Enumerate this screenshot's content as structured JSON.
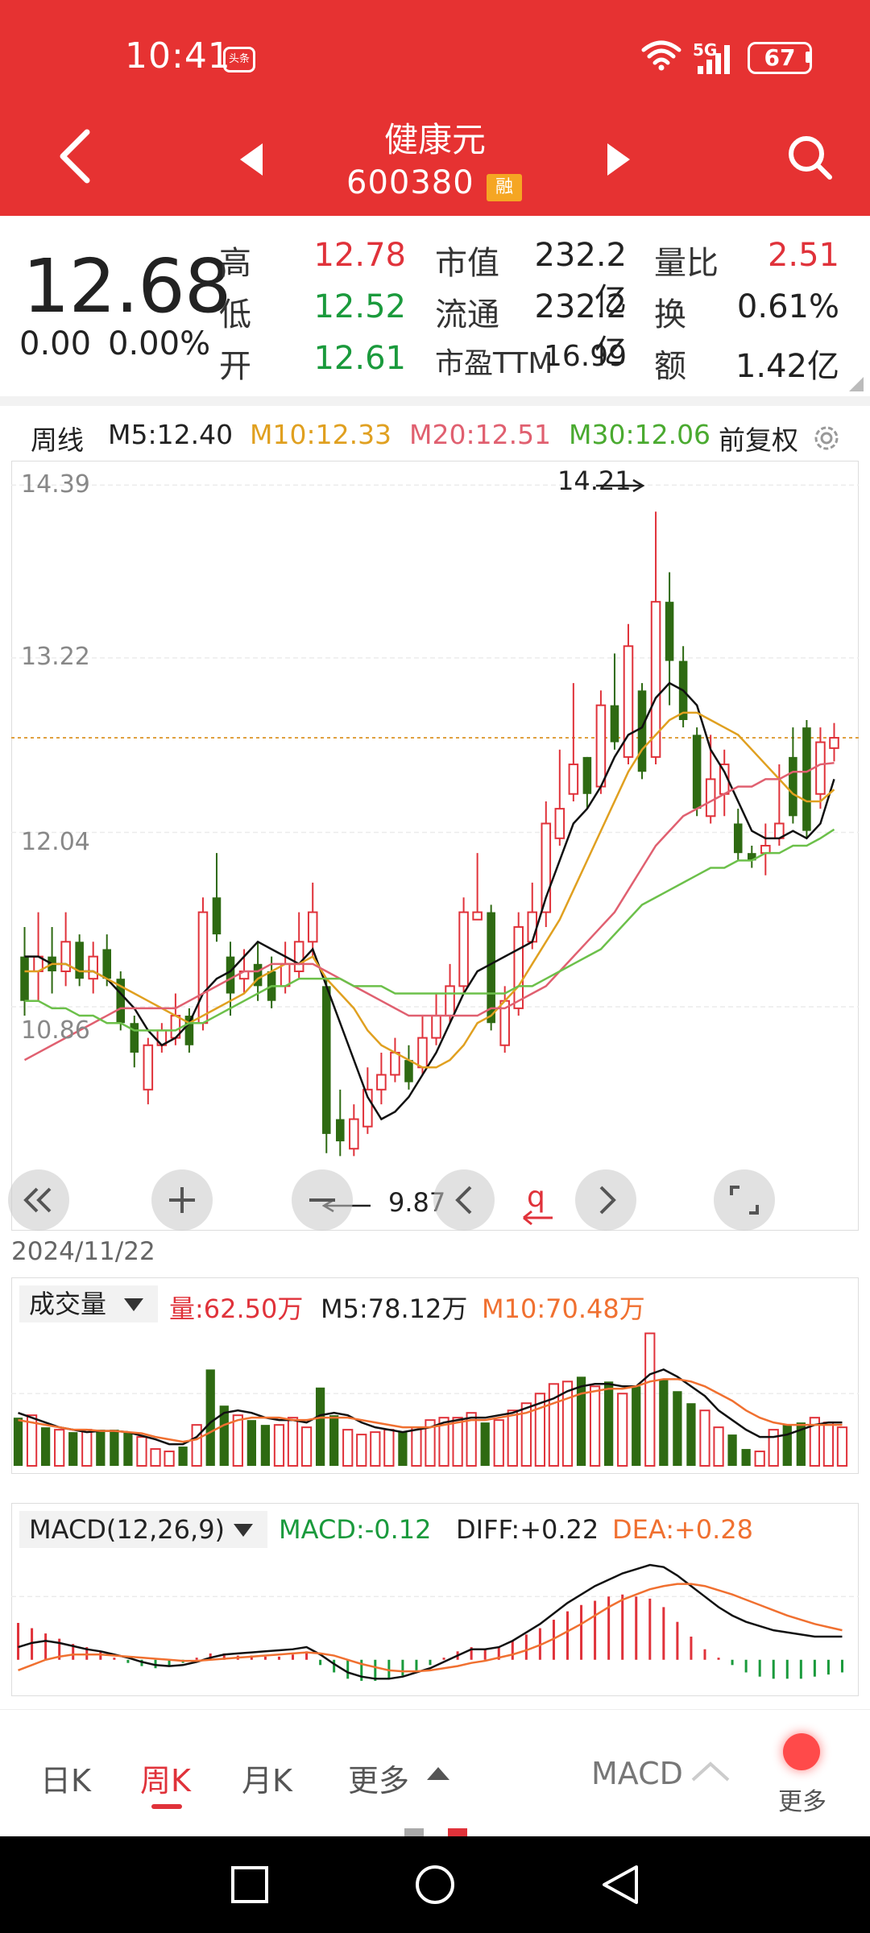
{
  "status_bar": {
    "time": "10:41",
    "toutiao": "头条",
    "network": "5G",
    "battery": "67"
  },
  "header": {
    "stock_name": "健康元",
    "stock_code": "600380",
    "badge": "融"
  },
  "quote": {
    "price": "12.68",
    "change": "0.00",
    "change_pct": "0.00%",
    "rows": [
      {
        "label": "高",
        "value": "12.78",
        "label2": "市值",
        "value2": "232.2亿",
        "label3": "量比",
        "value3": "2.51"
      },
      {
        "label": "低",
        "value": "12.52",
        "label2": "流通",
        "value2": "232.2亿",
        "label3": "换",
        "value3": "0.61%"
      },
      {
        "label": "开",
        "value": "12.61",
        "label2": "市盈TTM",
        "value2": "16.99",
        "label3": "额",
        "value3": "1.42亿"
      }
    ]
  },
  "ma_bar": {
    "period": "周线",
    "m5": "M5:12.40",
    "m10": "M10:12.33",
    "m20": "M20:12.51",
    "m30": "M30:12.06",
    "adjust": "前复权"
  },
  "colors": {
    "up": "#e0323a",
    "down": "#2e6a12",
    "m5": "#111111",
    "m10": "#e0a020",
    "m20": "#e06070",
    "m30": "#6cc04a",
    "header": "#e63232"
  },
  "chart_data": {
    "type": "candlestick",
    "y_ticks": [
      "14.39",
      "13.22",
      "12.04",
      "10.86"
    ],
    "ylim": [
      9.4,
      14.5
    ],
    "max_label": "14.21",
    "min_label": "9.87",
    "date_label": "2024/11/22",
    "current_price": 12.68,
    "candles": [
      [
        11.2,
        10.9,
        11.4,
        10.8
      ],
      [
        11.1,
        11.2,
        11.5,
        10.9
      ],
      [
        11.2,
        11.1,
        11.4,
        10.95
      ],
      [
        11.1,
        11.3,
        11.5,
        11.0
      ],
      [
        11.3,
        11.05,
        11.35,
        11.0
      ],
      [
        11.05,
        11.2,
        11.3,
        10.95
      ],
      [
        11.25,
        11.05,
        11.35,
        11.0
      ],
      [
        11.05,
        10.75,
        11.1,
        10.7
      ],
      [
        10.75,
        10.55,
        10.8,
        10.45
      ],
      [
        10.3,
        10.6,
        10.65,
        10.2
      ],
      [
        10.6,
        10.7,
        10.75,
        10.55
      ],
      [
        10.65,
        10.8,
        10.95,
        10.6
      ],
      [
        10.8,
        10.6,
        10.85,
        10.55
      ],
      [
        10.75,
        11.5,
        11.6,
        10.7
      ],
      [
        11.6,
        11.35,
        11.9,
        11.3
      ],
      [
        11.2,
        10.95,
        11.3,
        10.8
      ],
      [
        11.05,
        11.1,
        11.25,
        10.95
      ],
      [
        11.15,
        11.0,
        11.3,
        10.9
      ],
      [
        11.1,
        10.9,
        11.2,
        10.85
      ],
      [
        11.0,
        11.15,
        11.3,
        10.95
      ],
      [
        11.1,
        11.3,
        11.5,
        11.05
      ],
      [
        11.3,
        11.5,
        11.7,
        11.2
      ],
      [
        11.0,
        10.0,
        11.05,
        9.87
      ],
      [
        10.1,
        9.95,
        10.3,
        9.85
      ],
      [
        9.9,
        10.1,
        10.2,
        9.85
      ],
      [
        10.05,
        10.3,
        10.45,
        10.0
      ],
      [
        10.3,
        10.4,
        10.55,
        10.2
      ],
      [
        10.4,
        10.55,
        10.65,
        10.35
      ],
      [
        10.5,
        10.35,
        10.6,
        10.3
      ],
      [
        10.45,
        10.65,
        10.8,
        10.4
      ],
      [
        10.65,
        10.8,
        10.95,
        10.6
      ],
      [
        10.8,
        11.0,
        11.15,
        10.75
      ],
      [
        11.0,
        11.5,
        11.6,
        10.95
      ],
      [
        11.45,
        11.5,
        11.9,
        11.45
      ],
      [
        11.5,
        10.75,
        11.55,
        10.7
      ],
      [
        10.6,
        10.9,
        11.0,
        10.55
      ],
      [
        10.85,
        11.4,
        11.5,
        10.8
      ],
      [
        11.3,
        11.5,
        11.7,
        11.25
      ],
      [
        11.5,
        12.1,
        12.25,
        11.4
      ],
      [
        12.0,
        12.2,
        12.6,
        11.95
      ],
      [
        12.3,
        12.5,
        13.05,
        12.25
      ],
      [
        12.55,
        12.3,
        12.55,
        12.2
      ],
      [
        12.35,
        12.9,
        13.0,
        12.3
      ],
      [
        12.9,
        12.65,
        13.25,
        12.6
      ],
      [
        12.55,
        13.3,
        13.45,
        12.5
      ],
      [
        13.0,
        12.45,
        13.05,
        12.4
      ],
      [
        12.55,
        13.6,
        14.21,
        12.5
      ],
      [
        13.6,
        13.2,
        13.8,
        12.9
      ],
      [
        13.2,
        12.8,
        13.3,
        12.75
      ],
      [
        12.7,
        12.2,
        12.75,
        12.15
      ],
      [
        12.15,
        12.4,
        12.7,
        12.1
      ],
      [
        12.3,
        12.5,
        12.6,
        12.15
      ],
      [
        12.1,
        11.9,
        12.2,
        11.85
      ],
      [
        11.9,
        11.85,
        11.95,
        11.8
      ],
      [
        11.9,
        11.95,
        12.1,
        11.75
      ],
      [
        12.0,
        12.1,
        12.5,
        11.95
      ],
      [
        12.55,
        12.15,
        12.75,
        12.1
      ],
      [
        12.75,
        12.05,
        12.8,
        12.0
      ],
      [
        12.3,
        12.65,
        12.75,
        12.2
      ],
      [
        12.61,
        12.68,
        12.78,
        12.52
      ]
    ],
    "ma": {
      "m5": [
        11.2,
        11.2,
        11.15,
        11.15,
        11.1,
        11.1,
        11.05,
        10.95,
        10.85,
        10.7,
        10.6,
        10.65,
        10.75,
        10.95,
        11.05,
        11.1,
        11.2,
        11.3,
        11.25,
        11.2,
        11.15,
        11.25,
        11.0,
        10.75,
        10.5,
        10.25,
        10.1,
        10.15,
        10.25,
        10.4,
        10.55,
        10.75,
        10.95,
        11.1,
        11.15,
        11.2,
        11.25,
        11.3,
        11.6,
        11.85,
        12.1,
        12.2,
        12.35,
        12.55,
        12.7,
        12.75,
        12.95,
        13.05,
        13.0,
        12.9,
        12.6,
        12.45,
        12.25,
        12.05,
        12.0,
        12.0,
        12.05,
        12.0,
        12.1,
        12.4
      ],
      "m10": [
        11.1,
        11.1,
        11.15,
        11.15,
        11.1,
        11.1,
        11.05,
        11.0,
        10.95,
        10.9,
        10.85,
        10.8,
        10.75,
        10.8,
        10.85,
        10.9,
        10.95,
        11.05,
        11.1,
        11.15,
        11.15,
        11.2,
        11.05,
        10.95,
        10.85,
        10.7,
        10.6,
        10.55,
        10.5,
        10.45,
        10.45,
        10.5,
        10.6,
        10.75,
        10.8,
        10.9,
        11.0,
        11.15,
        11.3,
        11.45,
        11.65,
        11.85,
        12.05,
        12.25,
        12.45,
        12.6,
        12.7,
        12.8,
        12.85,
        12.85,
        12.8,
        12.75,
        12.7,
        12.6,
        12.5,
        12.4,
        12.3,
        12.25,
        12.25,
        12.33
      ],
      "m20": [
        10.5,
        10.55,
        10.6,
        10.65,
        10.7,
        10.75,
        10.8,
        10.85,
        10.85,
        10.85,
        10.85,
        10.85,
        10.9,
        10.95,
        11.0,
        11.05,
        11.1,
        11.1,
        11.15,
        11.15,
        11.15,
        11.15,
        11.1,
        11.05,
        11.0,
        10.95,
        10.9,
        10.85,
        10.8,
        10.8,
        10.8,
        10.8,
        10.8,
        10.8,
        10.85,
        10.85,
        10.9,
        10.95,
        11.0,
        11.1,
        11.2,
        11.3,
        11.4,
        11.5,
        11.65,
        11.8,
        11.95,
        12.05,
        12.15,
        12.2,
        12.25,
        12.3,
        12.35,
        12.35,
        12.4,
        12.4,
        12.45,
        12.45,
        12.5,
        12.51
      ],
      "m30": [
        10.9,
        10.9,
        10.85,
        10.85,
        10.8,
        10.8,
        10.75,
        10.75,
        10.7,
        10.7,
        10.7,
        10.7,
        10.75,
        10.75,
        10.8,
        10.85,
        10.9,
        10.95,
        11.0,
        11.0,
        11.05,
        11.05,
        11.05,
        11.05,
        11.0,
        11.0,
        11.0,
        10.95,
        10.95,
        10.95,
        10.95,
        10.95,
        10.95,
        10.95,
        10.95,
        10.95,
        11.0,
        11.0,
        11.05,
        11.1,
        11.15,
        11.2,
        11.25,
        11.35,
        11.45,
        11.55,
        11.6,
        11.65,
        11.7,
        11.75,
        11.8,
        11.8,
        11.85,
        11.85,
        11.9,
        11.9,
        11.95,
        11.95,
        12.0,
        12.06
      ]
    }
  },
  "volume": {
    "selector": "成交量",
    "vol": "量:62.50万",
    "m5": "M5:78.12万",
    "m10": "M10:70.48万",
    "bars": [
      40,
      42,
      32,
      30,
      28,
      30,
      30,
      30,
      28,
      24,
      14,
      12,
      16,
      34,
      80,
      50,
      42,
      38,
      34,
      34,
      40,
      32,
      65,
      42,
      30,
      26,
      28,
      30,
      28,
      32,
      38,
      40,
      40,
      44,
      36,
      38,
      46,
      52,
      60,
      68,
      70,
      74,
      66,
      70,
      60,
      66,
      110,
      72,
      62,
      52,
      46,
      32,
      26,
      14,
      12,
      30,
      34,
      36,
      40,
      36,
      32
    ],
    "m5_line": [
      44,
      40,
      36,
      32,
      30,
      28,
      29,
      29,
      28,
      25,
      22,
      18,
      18,
      24,
      36,
      44,
      46,
      44,
      40,
      38,
      38,
      36,
      42,
      44,
      42,
      36,
      32,
      30,
      28,
      30,
      32,
      36,
      38,
      40,
      40,
      42,
      44,
      48,
      52,
      56,
      62,
      66,
      68,
      68,
      66,
      66,
      76,
      80,
      74,
      66,
      58,
      46,
      38,
      30,
      24,
      24,
      26,
      30,
      34,
      36,
      36
    ],
    "m10_line": [
      38,
      36,
      34,
      32,
      30,
      30,
      29,
      29,
      28,
      27,
      24,
      22,
      20,
      22,
      28,
      34,
      38,
      40,
      40,
      40,
      38,
      38,
      40,
      40,
      40,
      38,
      36,
      34,
      32,
      32,
      32,
      34,
      36,
      38,
      38,
      40,
      42,
      44,
      48,
      52,
      56,
      60,
      62,
      64,
      64,
      66,
      70,
      72,
      72,
      70,
      66,
      60,
      54,
      46,
      40,
      36,
      34,
      34,
      34,
      34,
      34
    ]
  },
  "macd": {
    "selector": "MACD(12,26,9)",
    "macd": "MACD:-0.12",
    "diff": "DIFF:+0.22",
    "dea": "DEA:+0.28",
    "hist": [
      0.35,
      0.3,
      0.25,
      0.2,
      0.15,
      0.12,
      0.08,
      0.02,
      -0.03,
      -0.06,
      -0.08,
      -0.06,
      -0.03,
      0.02,
      0.06,
      0.06,
      0.04,
      0.04,
      0.03,
      0.03,
      0.05,
      0.08,
      -0.05,
      -0.12,
      -0.18,
      -0.2,
      -0.2,
      -0.18,
      -0.15,
      -0.1,
      -0.05,
      0.02,
      0.08,
      0.12,
      0.1,
      0.12,
      0.18,
      0.24,
      0.3,
      0.38,
      0.46,
      0.52,
      0.56,
      0.6,
      0.62,
      0.6,
      0.58,
      0.5,
      0.36,
      0.22,
      0.1,
      0.02,
      -0.05,
      -0.12,
      -0.16,
      -0.18,
      -0.18,
      -0.18,
      -0.16,
      -0.14,
      -0.12
    ],
    "diff_line": [
      0.12,
      0.16,
      0.18,
      0.16,
      0.13,
      0.1,
      0.08,
      0.05,
      0.02,
      -0.02,
      -0.05,
      -0.06,
      -0.05,
      -0.02,
      0.02,
      0.05,
      0.06,
      0.07,
      0.08,
      0.09,
      0.1,
      0.12,
      0.05,
      -0.04,
      -0.12,
      -0.16,
      -0.18,
      -0.18,
      -0.16,
      -0.12,
      -0.08,
      -0.02,
      0.04,
      0.1,
      0.1,
      0.12,
      0.18,
      0.26,
      0.34,
      0.44,
      0.54,
      0.62,
      0.7,
      0.76,
      0.82,
      0.86,
      0.9,
      0.88,
      0.8,
      0.7,
      0.6,
      0.5,
      0.42,
      0.36,
      0.32,
      0.28,
      0.26,
      0.24,
      0.22,
      0.22,
      0.22
    ],
    "dea_line": [
      -0.1,
      -0.05,
      0.0,
      0.03,
      0.05,
      0.05,
      0.05,
      0.04,
      0.03,
      0.02,
      0.01,
      0.0,
      -0.01,
      -0.01,
      0.0,
      0.01,
      0.02,
      0.03,
      0.04,
      0.05,
      0.06,
      0.07,
      0.06,
      0.04,
      0.0,
      -0.04,
      -0.07,
      -0.1,
      -0.11,
      -0.11,
      -0.1,
      -0.08,
      -0.06,
      -0.03,
      -0.01,
      0.02,
      0.05,
      0.09,
      0.14,
      0.2,
      0.27,
      0.34,
      0.42,
      0.5,
      0.57,
      0.62,
      0.67,
      0.7,
      0.72,
      0.72,
      0.7,
      0.66,
      0.62,
      0.57,
      0.52,
      0.47,
      0.42,
      0.38,
      0.34,
      0.31,
      0.28
    ]
  },
  "tabs": {
    "day": "日K",
    "week": "周K",
    "month": "月K",
    "more": "更多",
    "indicator": "MACD",
    "more2": "更多"
  }
}
